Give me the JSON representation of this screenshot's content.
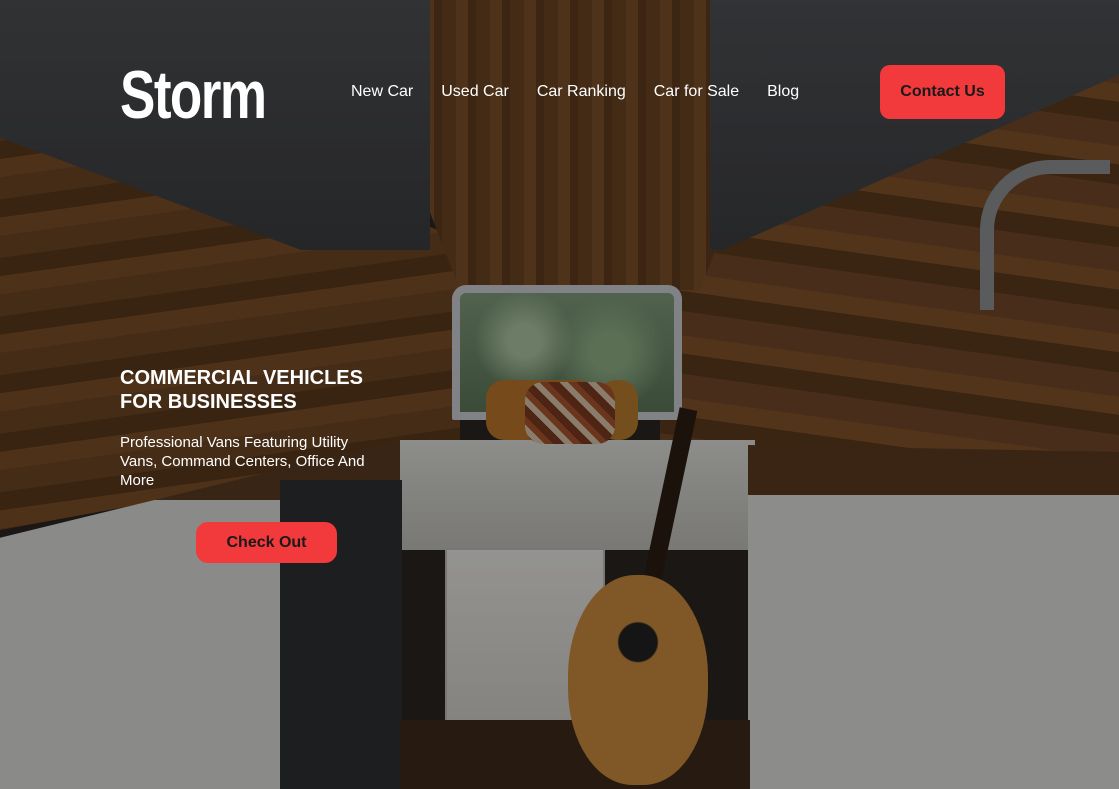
{
  "brand": {
    "logo_text": "Storm"
  },
  "nav": {
    "items": [
      {
        "label": "New Car"
      },
      {
        "label": "Used Car"
      },
      {
        "label": "Car Ranking"
      },
      {
        "label": "Car for Sale"
      },
      {
        "label": "Blog"
      }
    ],
    "contact_label": "Contact Us"
  },
  "hero": {
    "title_line1": "COMMERCIAL VEHICLES",
    "title_line2": "FOR BUSINESSES",
    "description": "Professional Vans Featuring Utility Vans, Command Centers, Office And More",
    "cta_label": "Check Out"
  },
  "colors": {
    "accent": "#f2393b",
    "text_light": "#ffffff",
    "button_text": "#1a1a1a"
  }
}
